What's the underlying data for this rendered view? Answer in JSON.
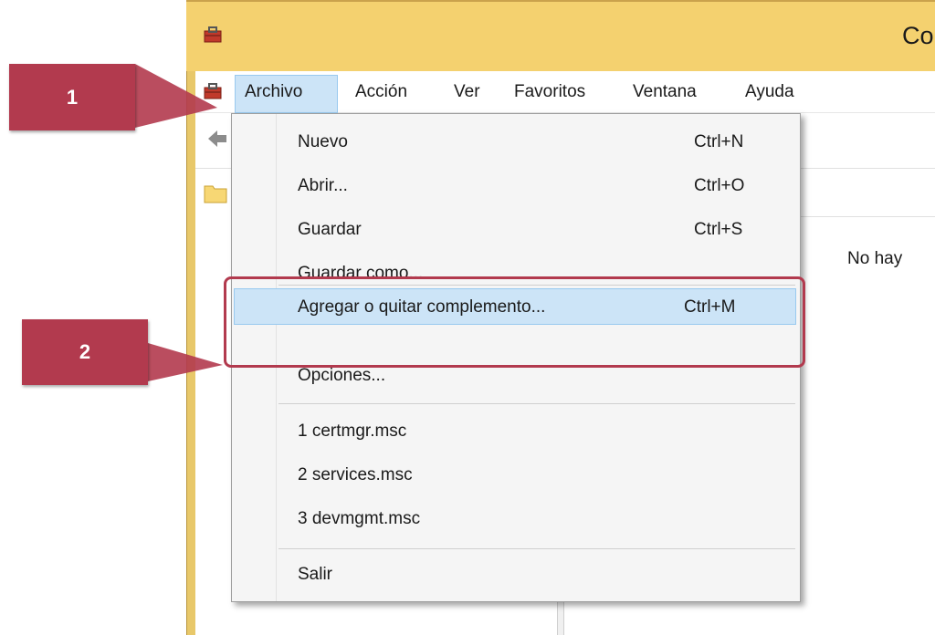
{
  "window": {
    "title": "Co"
  },
  "menubar": {
    "items": [
      "Archivo",
      "Acción",
      "Ver",
      "Favoritos",
      "Ventana",
      "Ayuda"
    ],
    "active": "Archivo"
  },
  "content": {
    "empty_text": "No hay"
  },
  "file_menu": {
    "items": [
      {
        "label": "Nuevo",
        "shortcut": "Ctrl+N"
      },
      {
        "label": "Abrir...",
        "shortcut": "Ctrl+O"
      },
      {
        "label": "Guardar",
        "shortcut": "Ctrl+S"
      },
      {
        "label": "Guardar como...",
        "shortcut": ""
      },
      {
        "label": "Agregar o quitar complemento...",
        "shortcut": "Ctrl+M"
      },
      {
        "label": "Opciones...",
        "shortcut": ""
      },
      {
        "label": "1 certmgr.msc",
        "shortcut": ""
      },
      {
        "label": "2 services.msc",
        "shortcut": ""
      },
      {
        "label": "3 devmgmt.msc",
        "shortcut": ""
      },
      {
        "label": "Salir",
        "shortcut": ""
      }
    ],
    "highlighted_item": "Agregar o quitar complemento..."
  },
  "callouts": {
    "one": "1",
    "two": "2"
  },
  "colors": {
    "titlebar": "#f4d16f",
    "highlight": "#cce4f7",
    "callout": "#b23a4e"
  }
}
